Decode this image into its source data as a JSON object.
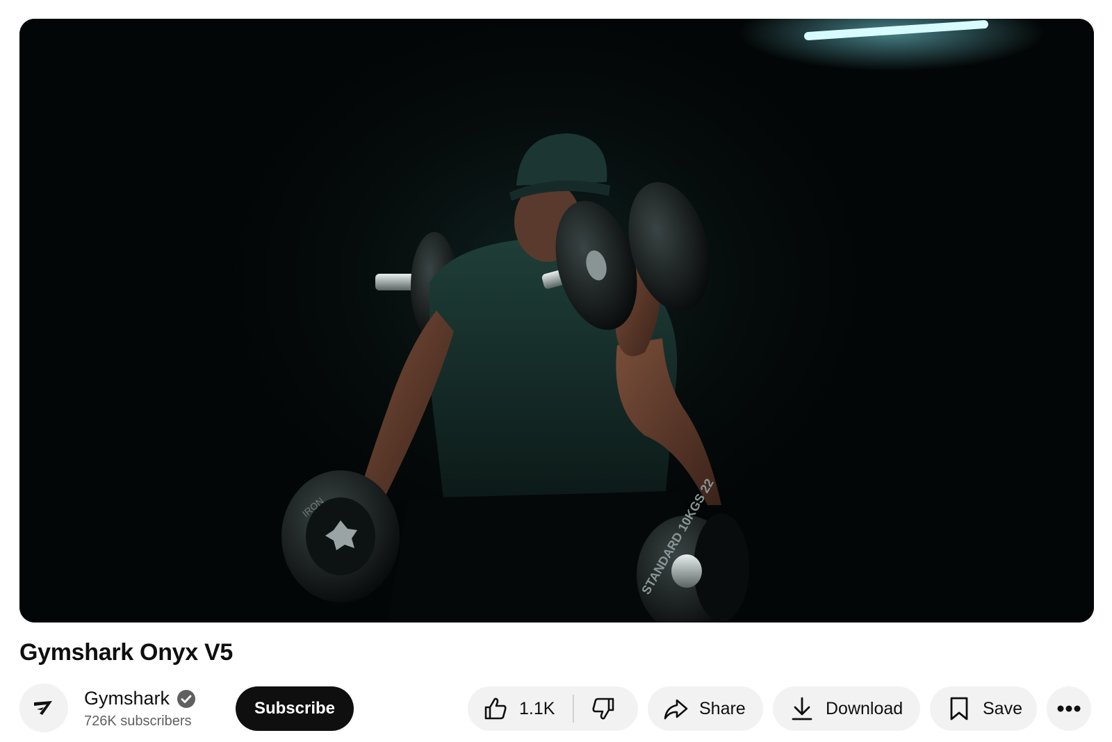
{
  "video": {
    "title": "Gymshark Onyx V5",
    "scene": {
      "plate_left_text": "IRON",
      "plate_right_text": "STANDARD 10KGS 22"
    }
  },
  "channel": {
    "name": "Gymshark",
    "verified": true,
    "subscribers": "726K subscribers",
    "avatar_icon": "gymshark-logo-icon"
  },
  "actions": {
    "subscribe_label": "Subscribe",
    "like_count": "1.1K",
    "share_label": "Share",
    "download_label": "Download",
    "save_label": "Save"
  },
  "colors": {
    "button_bg": "#f2f2f2",
    "subscribe_bg": "#0f0f0f",
    "text_primary": "#0f0f0f",
    "text_secondary": "#606060"
  }
}
